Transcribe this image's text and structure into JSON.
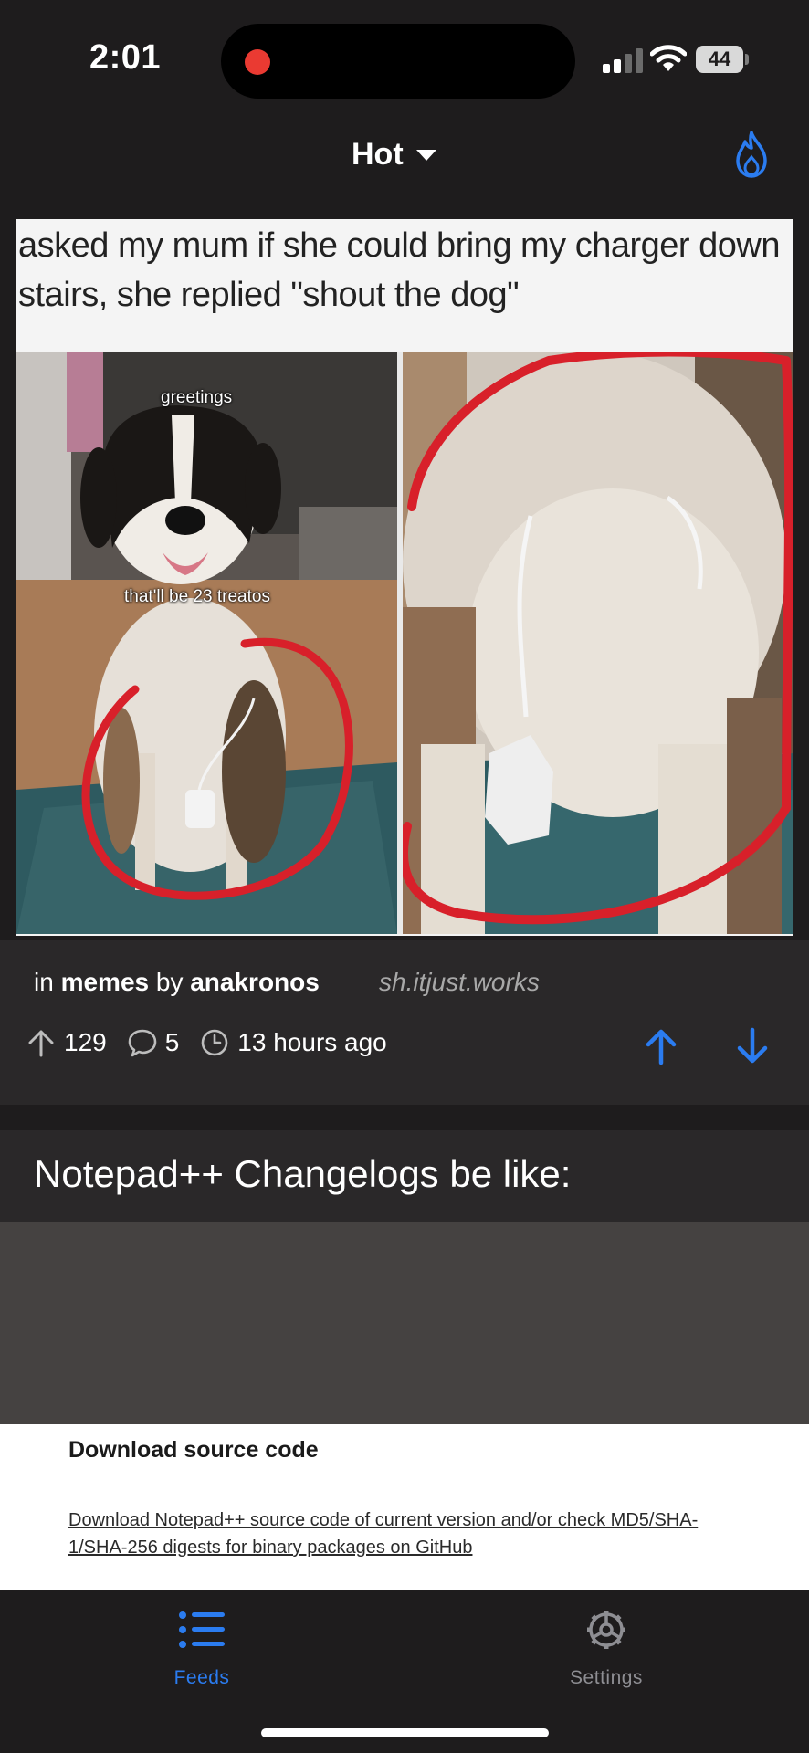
{
  "status_bar": {
    "time": "2:01",
    "battery": "44"
  },
  "header": {
    "sort_label": "Hot"
  },
  "post1": {
    "meme_caption": "asked my mum if she could bring my charger down stairs, she replied \"shout the dog\"",
    "meme_text_1": "greetings",
    "meme_text_2": "that'll be 23 treatos",
    "prefix": "in",
    "community": "memes",
    "by_label": "by",
    "author": "anakronos",
    "instance": "sh.itjust.works",
    "score": "129",
    "comments": "5",
    "time_ago": "13 hours ago"
  },
  "post2": {
    "title": "Notepad++ Changelogs be like:",
    "preview_heading": "Download source code",
    "preview_link": "Download Notepad++ source code of current version and/or check MD5/SHA-1/SHA-256 digests for binary packages on GitHub"
  },
  "tabs": [
    {
      "label": "Feeds",
      "icon": "list-icon",
      "active": true
    },
    {
      "label": "Settings",
      "icon": "gear-icon",
      "active": false
    }
  ],
  "colors": {
    "accent": "#2b7cf0",
    "background": "#1e1c1d",
    "card": "#2a2829",
    "recording": "#ea3a32",
    "inactive": "#8e8e93"
  }
}
